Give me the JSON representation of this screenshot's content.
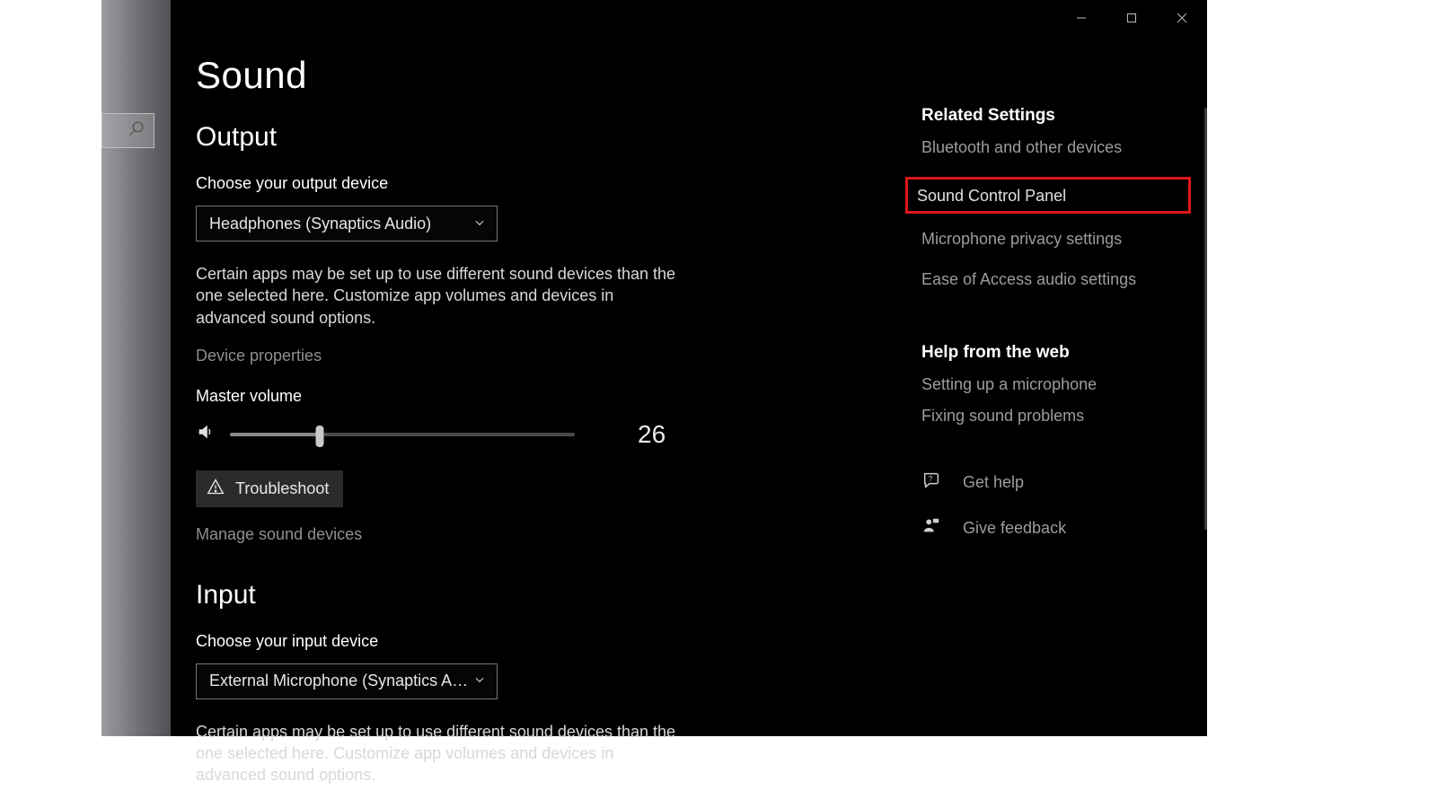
{
  "titlebar": {
    "minimize": "Minimize",
    "maximize": "Maximize",
    "close": "Close"
  },
  "page": {
    "title": "Sound"
  },
  "output": {
    "heading": "Output",
    "choose_label": "Choose your output device",
    "device_selected": "Headphones (Synaptics Audio)",
    "description": "Certain apps may be set up to use different sound devices than the one selected here. Customize app volumes and devices in advanced sound options.",
    "device_properties": "Device properties",
    "master_volume_label": "Master volume",
    "volume_value": 26,
    "troubleshoot_label": "Troubleshoot",
    "manage_label": "Manage sound devices"
  },
  "input": {
    "heading": "Input",
    "choose_label": "Choose your input device",
    "device_selected": "External Microphone (Synaptics Aud...",
    "description": "Certain apps may be set up to use different sound devices than the one selected here. Customize app volumes and devices in advanced sound options."
  },
  "related": {
    "heading": "Related Settings",
    "items": [
      "Bluetooth and other devices",
      "Sound Control Panel",
      "Microphone privacy settings",
      "Ease of Access audio settings"
    ],
    "highlight_index": 1
  },
  "help": {
    "heading": "Help from the web",
    "items": [
      "Setting up a microphone",
      "Fixing sound problems"
    ]
  },
  "support": {
    "get_help": "Get help",
    "give_feedback": "Give feedback"
  },
  "colors": {
    "highlight_border": "#e01616"
  }
}
